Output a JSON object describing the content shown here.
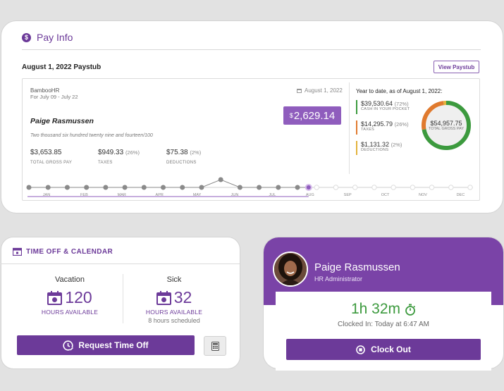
{
  "pay_info": {
    "title": "Pay Info",
    "paystub_date": "August 1, 2022 Paystub",
    "view_button": "View Paystub",
    "company": "BambooHR",
    "period": "For July 09 - July 22",
    "pay_date": "August 1, 2022",
    "net_currency": "$",
    "net_amount": "2,629.14",
    "employee_name": "Paige Rasmussen",
    "amount_words": "Two thousand six hundred twenty nine and fourteen/100",
    "stats": [
      {
        "value": "$3,653.85",
        "pct": "",
        "label": "TOTAL GROSS PAY"
      },
      {
        "value": "$949.33",
        "pct": "(26%)",
        "label": "TAXES"
      },
      {
        "value": "$75.38",
        "pct": "(2%)",
        "label": "DEDUCTIONS"
      }
    ],
    "ytd": {
      "title": "Year to date, as of August 1, 2022:",
      "rows": [
        {
          "value": "$39,530.64",
          "pct": "(72%)",
          "label": "CASH IN YOUR POCKET",
          "color": "#3c9a3e"
        },
        {
          "value": "$14,295.79",
          "pct": "(26%)",
          "label": "TAXES",
          "color": "#e07a2e"
        },
        {
          "value": "$1,131.32",
          "pct": "(2%)",
          "label": "DEDUCTIONS",
          "color": "#e3b23c"
        }
      ],
      "donut_fractions": [
        0.72,
        0.26,
        0.02
      ],
      "total_value": "$54,957.75",
      "total_label": "TOTAL GROSS PAY"
    },
    "months": [
      "JAN",
      "FEB",
      "MAR",
      "APR",
      "MAY",
      "JUN",
      "JUL",
      "AUG",
      "SEP",
      "OCT",
      "NOV",
      "DEC"
    ],
    "current_month": "AUG"
  },
  "time_off": {
    "title": "TIME OFF & CALENDAR",
    "vacation": {
      "label": "Vacation",
      "hours": "120",
      "unit": "HOURS AVAILABLE",
      "scheduled": ""
    },
    "sick": {
      "label": "Sick",
      "hours": "32",
      "unit": "HOURS AVAILABLE",
      "scheduled": "8 hours scheduled"
    },
    "request_button": "Request Time Off"
  },
  "clock": {
    "name": "Paige Rasmussen",
    "role": "HR Administrator",
    "elapsed": "1h 32m",
    "clocked_in": "Clocked In: Today at 6:47 AM",
    "button": "Clock Out"
  }
}
